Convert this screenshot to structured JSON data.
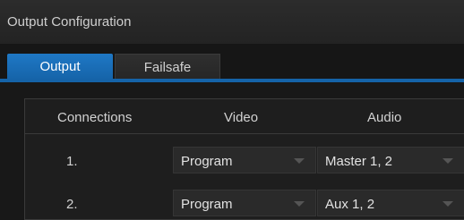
{
  "window": {
    "title": "Output Configuration"
  },
  "tabs": [
    {
      "label": "Output",
      "active": true
    },
    {
      "label": "Failsafe",
      "active": false
    }
  ],
  "table": {
    "headers": {
      "connections": "Connections",
      "video": "Video",
      "audio": "Audio"
    },
    "rows": [
      {
        "number": "1.",
        "video": "Program",
        "audio": "Master 1, 2"
      },
      {
        "number": "2.",
        "video": "Program",
        "audio": "Aux 1, 2"
      }
    ]
  },
  "colors": {
    "accent": "#1f78c5",
    "background": "#181818"
  }
}
